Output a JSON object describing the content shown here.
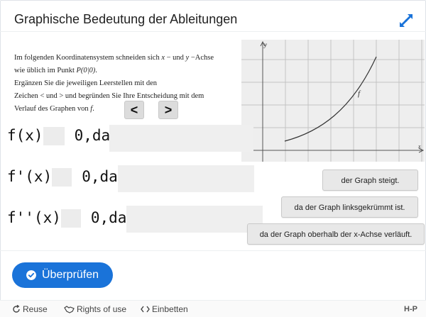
{
  "header": {
    "title": "Graphische Bedeutung der Ableitungen",
    "fullscreen_icon": "expand-arrows-icon"
  },
  "task": {
    "line1_a": "Im folgenden Koordinatensystem schneiden sich ",
    "line1_x": "x",
    "line1_b": " − und ",
    "line1_y": "y",
    "line1_c": " −Achse",
    "line2_a": "wie üblich im Punkt ",
    "line2_p": "P(0|0)",
    "line2_b": ".",
    "line3": "Ergänzen Sie die jeweiligen Leerstellen mit den",
    "line4_a": "Zeichen ",
    "line4_lt": "<",
    "line4_mid": " und ",
    "line4_gt": ">",
    "line4_b": " und begründen Sie Ihre Entscheidung mit dem",
    "line5_a": "Verlauf des Graphen von ",
    "line5_f": "f",
    "line5_b": "."
  },
  "symbols": {
    "lt": "<",
    "gt": ">"
  },
  "graph": {
    "y_label": "y",
    "x_label": "x",
    "curve_label": "f"
  },
  "expressions": [
    {
      "lhs": "f(x)",
      "rhs": "0,da"
    },
    {
      "lhs": "f'(x)",
      "rhs": "0,da"
    },
    {
      "lhs": "f''(x)",
      "rhs": "0,da"
    }
  ],
  "options": [
    "der Graph steigt.",
    "da der Graph linksgekrümmt ist.",
    "da der Graph oberhalb der x-Achse verläuft."
  ],
  "actions": {
    "check_label": "Überprüfen",
    "check_icon": "check-circle-icon"
  },
  "footer": {
    "reuse": "Reuse",
    "rights": "Rights of use",
    "embed": "Einbetten",
    "logo": "H-P"
  }
}
